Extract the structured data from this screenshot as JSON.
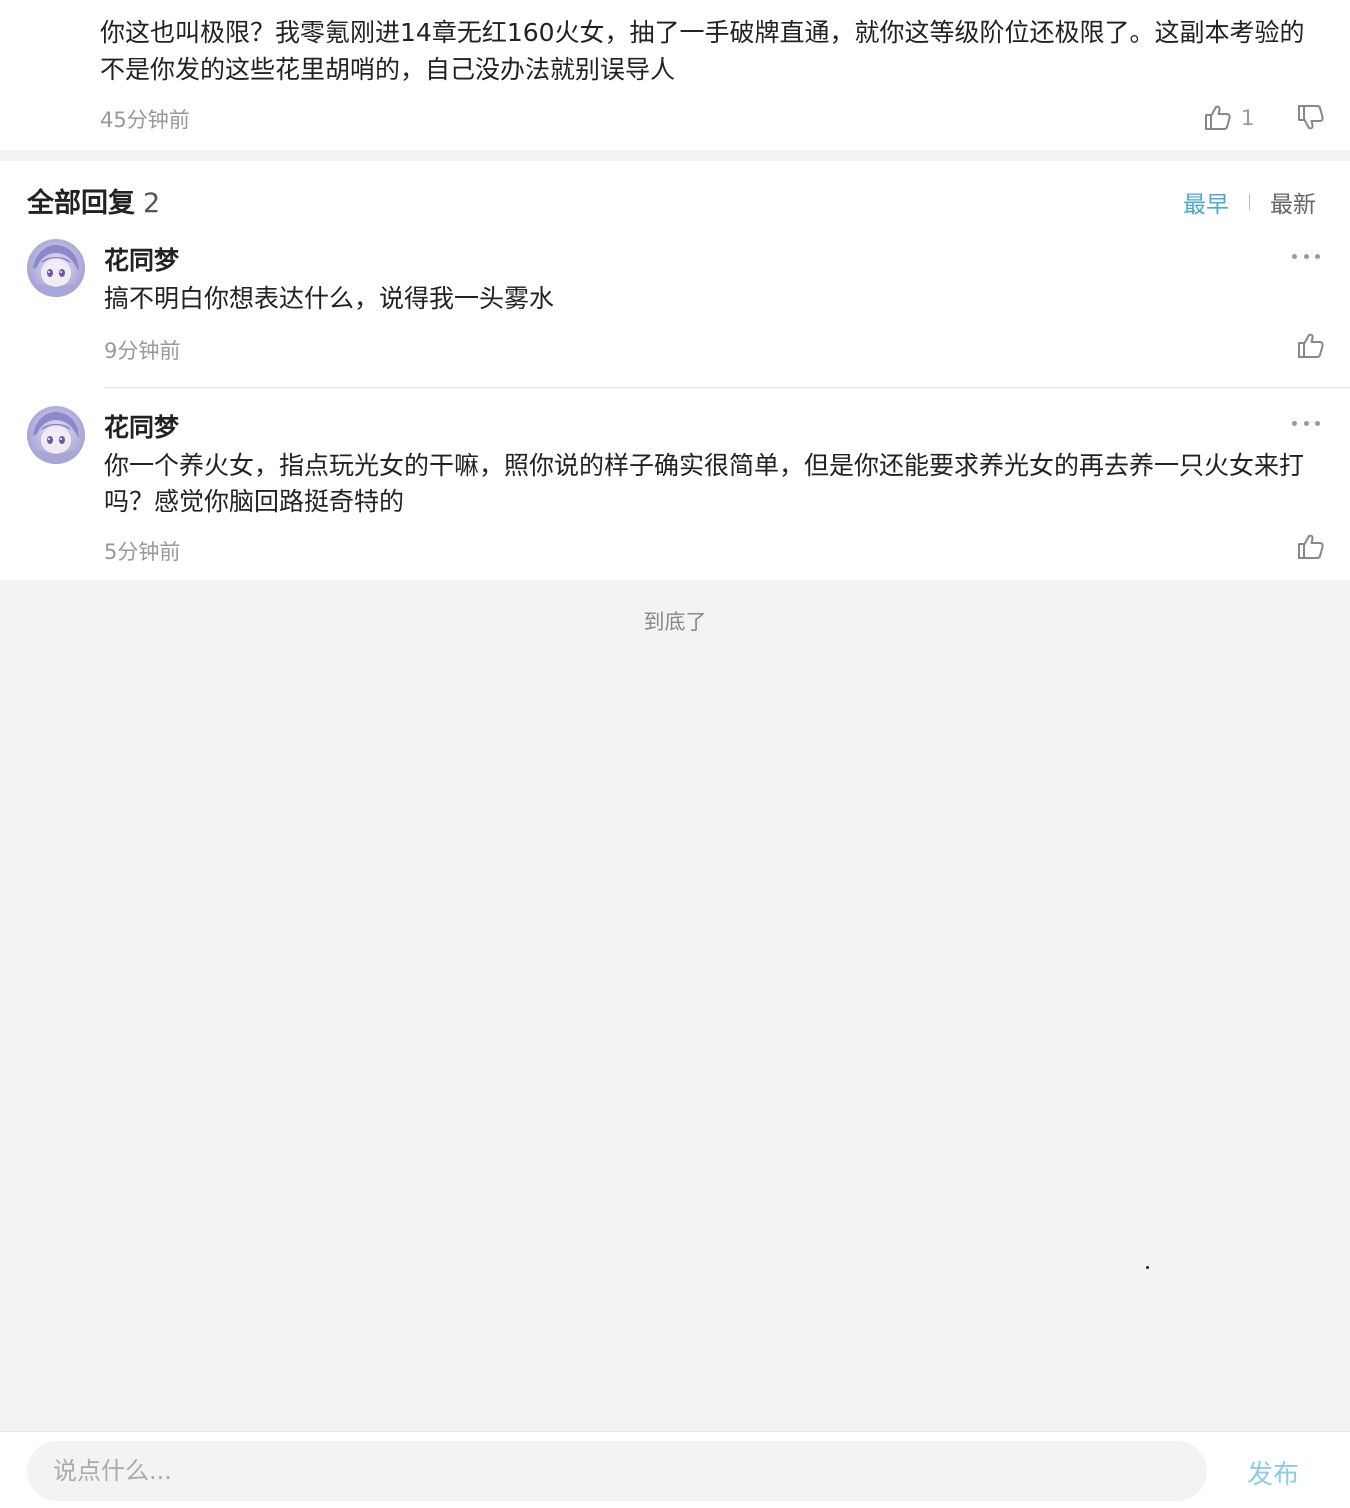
{
  "top_comment": {
    "text": "你这也叫极限？我零氪刚进14章无红160火女，抽了一手破牌直通，就你这等级阶位还极限了。这副本考验的不是你发的这些花里胡哨的，自己没办法就别误导人",
    "time": "45分钟前",
    "like_count": "1",
    "like_icon": "thumbs-up-icon",
    "dislike_icon": "thumbs-down-icon"
  },
  "replies_section": {
    "title": "全部回复",
    "count": "2",
    "sort_earliest": "最早",
    "sort_newest": "最新",
    "active_sort_color": "#4ba9d6"
  },
  "replies": [
    {
      "author": "花同梦",
      "text": "搞不明白你想表达什么，说得我一头雾水",
      "time": "9分钟前"
    },
    {
      "author": "花同梦",
      "text": "你一个养火女，指点玩光女的干嘛，照你说的样子确实很简单，但是你还能要求养光女的再去养一只火女来打吗？感觉你脑回路挺奇特的",
      "time": "5分钟前"
    }
  ],
  "end_text": "到底了",
  "bottom_bar": {
    "input_placeholder": "说点什么...",
    "publish_label": "发布",
    "publish_color": "#8dcbe8"
  }
}
